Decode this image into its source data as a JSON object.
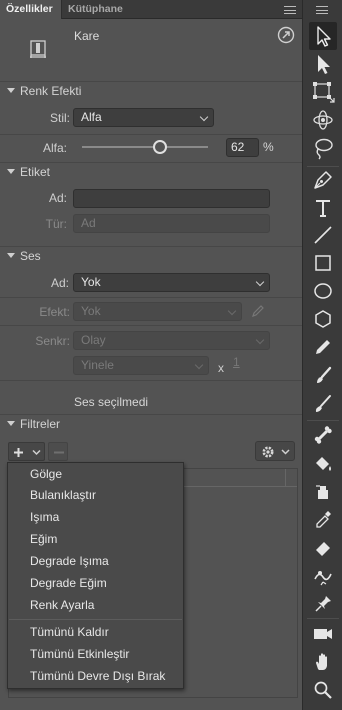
{
  "tabs": [
    {
      "label": "Özellikler",
      "active": true
    },
    {
      "label": "Kütüphane",
      "active": false
    }
  ],
  "document": {
    "name": "Kare"
  },
  "color_effect": {
    "title": "Renk Efekti",
    "style_label": "Stil:",
    "style_value": "Alfa",
    "alpha_label": "Alfa:",
    "alpha_value": "62",
    "alpha_unit": "%",
    "alpha_fraction": 0.62
  },
  "label_section": {
    "title": "Etiket",
    "name_label": "Ad:",
    "name_value": "",
    "type_label": "Tür:",
    "type_value": "Ad"
  },
  "sound": {
    "title": "Ses",
    "name_label": "Ad:",
    "name_value": "Yok",
    "effect_label": "Efekt:",
    "effect_value": "Yok",
    "sync_label": "Senkr:",
    "sync_value": "Olay",
    "repeat_value": "Yinele",
    "repeat_x": "x",
    "repeat_count": "1",
    "status": "Ses seçilmedi"
  },
  "filters": {
    "title": "Filtreler",
    "menu_items": [
      "Gölge",
      "Bulanıklaştır",
      "Işıma",
      "Eğim",
      "Degrade Işıma",
      "Degrade Eğim",
      "Renk Ayarla",
      "Tümünü Kaldır",
      "Tümünü Etkinleştir",
      "Tümünü Devre Dışı Bırak"
    ]
  },
  "tools": [
    "selection-tool-icon",
    "subselection-tool-icon",
    "free-transform-tool-icon",
    "3d-rotation-tool-icon",
    "lasso-tool-icon",
    "pen-tool-icon",
    "text-tool-icon",
    "line-tool-icon",
    "rectangle-tool-icon",
    "oval-tool-icon",
    "polystar-tool-icon",
    "pencil-tool-icon",
    "paint-brush-tool-icon",
    "brush-tool-icon",
    "bone-tool-icon",
    "paint-bucket-tool-icon",
    "ink-bottle-tool-icon",
    "eyedropper-tool-icon",
    "eraser-tool-icon",
    "width-tool-icon",
    "pin-tool-icon",
    "camera-tool-icon",
    "hand-tool-icon",
    "zoom-tool-icon"
  ],
  "colors": {
    "panel_bg": "#535353",
    "field_bg": "#3e3e3e",
    "toolbar_bg": "#3a3a3a",
    "text": "#d6d6d6"
  }
}
